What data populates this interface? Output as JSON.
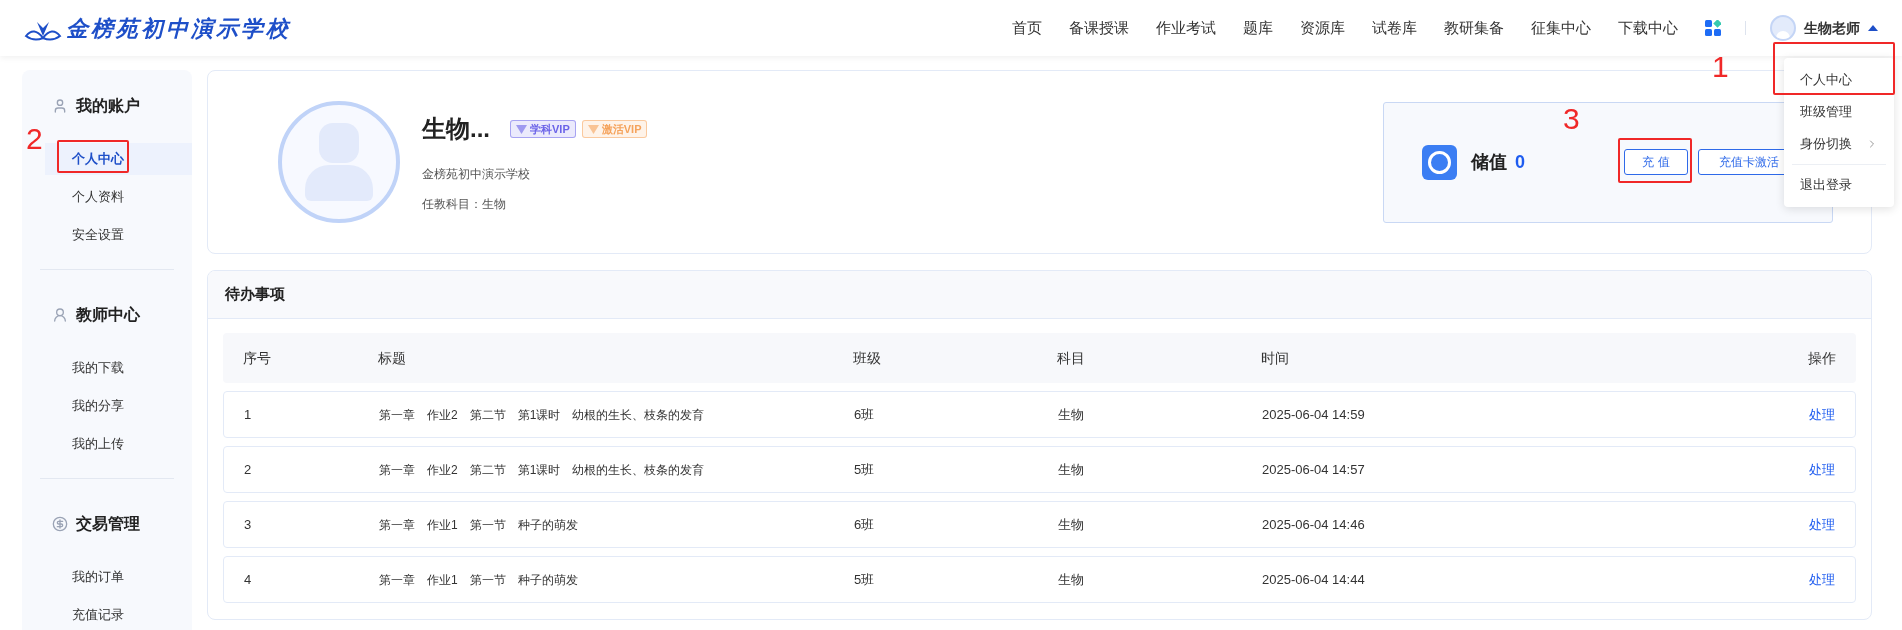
{
  "header": {
    "logo_text": "金榜苑初中演示学校",
    "nav": [
      "首页",
      "备课授课",
      "作业考试",
      "题库",
      "资源库",
      "试卷库",
      "教研集备",
      "征集中心",
      "下载中心"
    ],
    "user_name": "生物老师"
  },
  "user_menu": {
    "items": [
      {
        "label": "个人中心",
        "kind": "plain"
      },
      {
        "label": "班级管理",
        "kind": "plain"
      },
      {
        "label": "身份切换",
        "kind": "submenu"
      },
      {
        "label": "退出登录",
        "kind": "plain"
      }
    ]
  },
  "sidebar": {
    "sections": [
      {
        "title": "我的账户",
        "items": [
          {
            "label": "个人中心",
            "selected": true
          },
          {
            "label": "个人资料",
            "selected": false
          },
          {
            "label": "安全设置",
            "selected": false
          }
        ]
      },
      {
        "title": "教师中心",
        "items": [
          {
            "label": "我的下载",
            "selected": false
          },
          {
            "label": "我的分享",
            "selected": false
          },
          {
            "label": "我的上传",
            "selected": false
          }
        ]
      },
      {
        "title": "交易管理",
        "items": [
          {
            "label": "我的订单",
            "selected": false
          },
          {
            "label": "充值记录",
            "selected": false
          }
        ]
      }
    ]
  },
  "profile": {
    "name": "生物...",
    "badges": [
      {
        "label": "学科VIP",
        "color": "#6b63e8"
      },
      {
        "label": "激活VIP",
        "color": "#f5a35c"
      }
    ],
    "school": "金榜苑初中演示学校",
    "subject": "任教科目：生物"
  },
  "balance": {
    "label": "储值",
    "value": "0",
    "buttons": [
      "充 值",
      "充值卡激活"
    ]
  },
  "todo": {
    "title": "待办事项",
    "columns": [
      "序号",
      "标题",
      "班级",
      "科目",
      "时间",
      "操作"
    ],
    "rows": [
      {
        "no": "1",
        "title": "第一章　作业2　第二节　第1课时　幼根的生长、枝条的发育",
        "class": "6班",
        "subject": "生物",
        "time": "2025-06-04 14:59",
        "action": "处理"
      },
      {
        "no": "2",
        "title": "第一章　作业2　第二节　第1课时　幼根的生长、枝条的发育",
        "class": "5班",
        "subject": "生物",
        "time": "2025-06-04 14:57",
        "action": "处理"
      },
      {
        "no": "3",
        "title": "第一章　作业1　第一节　种子的萌发",
        "class": "6班",
        "subject": "生物",
        "time": "2025-06-04 14:46",
        "action": "处理"
      },
      {
        "no": "4",
        "title": "第一章　作业1　第一节　种子的萌发",
        "class": "5班",
        "subject": "生物",
        "time": "2025-06-04 14:44",
        "action": "处理"
      }
    ]
  },
  "annotations": [
    {
      "label": "1"
    },
    {
      "label": "2"
    },
    {
      "label": "3"
    }
  ]
}
